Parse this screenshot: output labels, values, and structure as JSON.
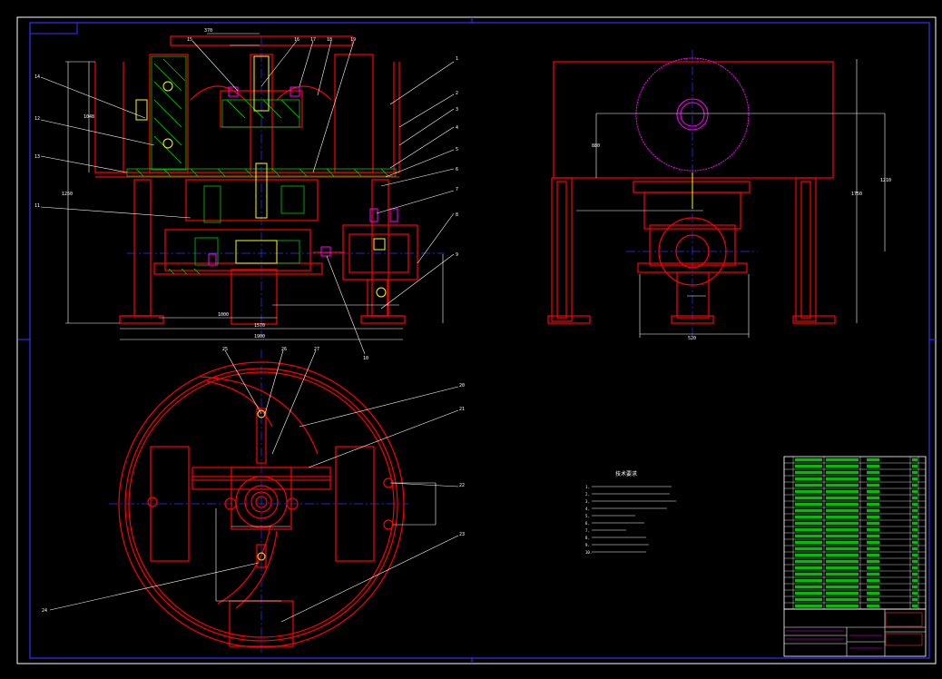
{
  "drawing": {
    "background": "#000000",
    "colors": {
      "outline": "#ff0000",
      "centerline": "#3333ff",
      "frame": "#2222ee",
      "dimension": "#ffffff",
      "hatch": "#00cc00",
      "part": "#ffff00",
      "sheave": "#ff00ff",
      "table_text": "#00ff00",
      "table_accent": "#ff3333"
    }
  },
  "front_view": {
    "balloons": [
      "1",
      "2",
      "3",
      "4",
      "5",
      "6",
      "7",
      "8",
      "9",
      "10",
      "11",
      "12",
      "13",
      "14",
      "15",
      "16",
      "17",
      "18",
      "19"
    ],
    "dims": [
      "370",
      "1048",
      "1250",
      "1900",
      "1000",
      "1570"
    ]
  },
  "side_view": {
    "dims": [
      "880",
      "1750",
      "1210",
      "520"
    ]
  },
  "plan_view": {
    "balloons": [
      "20",
      "21",
      "22",
      "23",
      "24",
      "25",
      "26",
      "27"
    ]
  },
  "tech_requirements": {
    "title": "技术要求",
    "items": [
      "1.",
      "2.",
      "3.",
      "4.",
      "5.",
      "6.",
      "7.",
      "8.",
      "9.",
      "10."
    ]
  },
  "parts_table": {
    "rows": 24
  },
  "title_block": {
    "title": "",
    "drawing_no": ""
  }
}
